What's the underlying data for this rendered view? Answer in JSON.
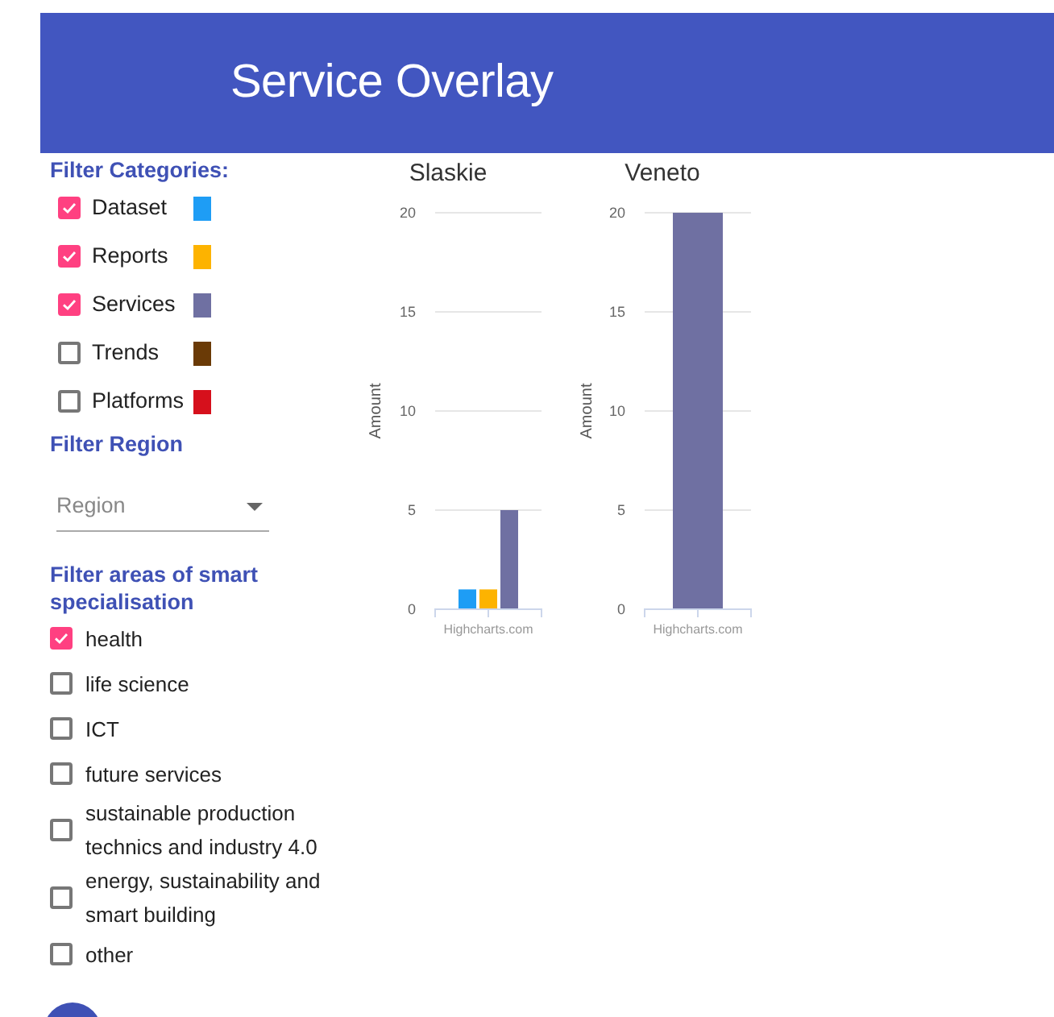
{
  "header": {
    "title": "Service Overlay"
  },
  "categories": {
    "heading": "Filter Categories:",
    "items": [
      {
        "label": "Dataset",
        "checked": true,
        "color": "#1e9df5"
      },
      {
        "label": "Reports",
        "checked": true,
        "color": "#fdb300"
      },
      {
        "label": "Services",
        "checked": true,
        "color": "#6f70a2"
      },
      {
        "label": "Trends",
        "checked": false,
        "color": "#6a3a06"
      },
      {
        "label": "Platforms",
        "checked": false,
        "color": "#d6101c"
      }
    ]
  },
  "region": {
    "heading": "Filter Region",
    "placeholder": "Region"
  },
  "areas": {
    "heading": "Filter areas of smart specialisation",
    "items": [
      {
        "label": "health",
        "checked": true
      },
      {
        "label": "life science",
        "checked": false
      },
      {
        "label": "ICT",
        "checked": false
      },
      {
        "label": "future services",
        "checked": false
      },
      {
        "label": "sustainable production technics and industry 4.0",
        "checked": false
      },
      {
        "label": "energy, sustainability and smart building",
        "checked": false
      },
      {
        "label": "other",
        "checked": false
      }
    ]
  },
  "charts": [
    {
      "credit": "Highcharts.com",
      "chart_data": {
        "type": "bar",
        "grid": true,
        "title": "Slaskie",
        "ylabel": "Amount",
        "ylim": [
          0,
          20
        ],
        "yticks": [
          0,
          5,
          10,
          15,
          20
        ],
        "series": [
          {
            "color": "#1e9df5",
            "values": [
              1
            ]
          },
          {
            "color": "#fdb300",
            "values": [
              1
            ]
          },
          {
            "color": "#6f70a2",
            "values": [
              5
            ]
          }
        ]
      }
    },
    {
      "credit": "Highcharts.com",
      "chart_data": {
        "type": "bar",
        "grid": true,
        "title": "Veneto",
        "ylabel": "Amount",
        "ylim": [
          0,
          20
        ],
        "yticks": [
          0,
          5,
          10,
          15,
          20
        ],
        "series": [
          {
            "color": "#6f70a2",
            "values": [
              20
            ]
          }
        ]
      }
    }
  ]
}
